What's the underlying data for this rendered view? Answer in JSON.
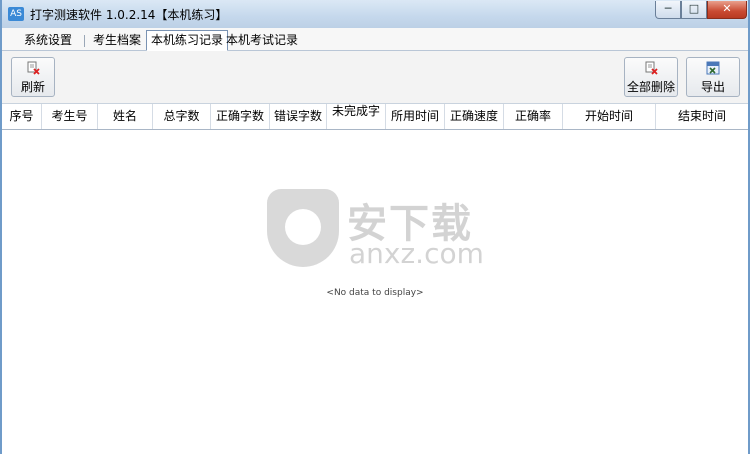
{
  "window": {
    "title": "打字测速软件 1.0.2.14【本机练习】",
    "app_icon": "AS",
    "controls": {
      "minimize": "─",
      "maximize": "□",
      "close": "✕"
    }
  },
  "tabs": [
    {
      "label": "系统设置",
      "active": false
    },
    {
      "label": "考生档案",
      "active": false
    },
    {
      "label": "本机练习记录",
      "active": true
    },
    {
      "label": "本机考试记录",
      "active": false
    }
  ],
  "toolbar": {
    "refresh_label": "刷新",
    "delete_all_label": "全部删除",
    "export_label": "导出",
    "icons": {
      "refresh": "document-delete-icon",
      "delete_all": "document-delete-icon",
      "export": "excel-export-icon"
    }
  },
  "grid": {
    "columns": [
      "序号",
      "考生号",
      "姓名",
      "总字数",
      "正确字数",
      "错误字数",
      "未完成字",
      "所用时间",
      "正确速度",
      "正确率",
      "开始时间",
      "结束时间"
    ],
    "rows": [],
    "empty_text": "<No data to display>"
  },
  "watermark": {
    "cn": "安下载",
    "en": "anxz.com"
  },
  "colors": {
    "accent": "#3a89d6",
    "close": "#c94a32",
    "border": "#6f9bc9"
  }
}
